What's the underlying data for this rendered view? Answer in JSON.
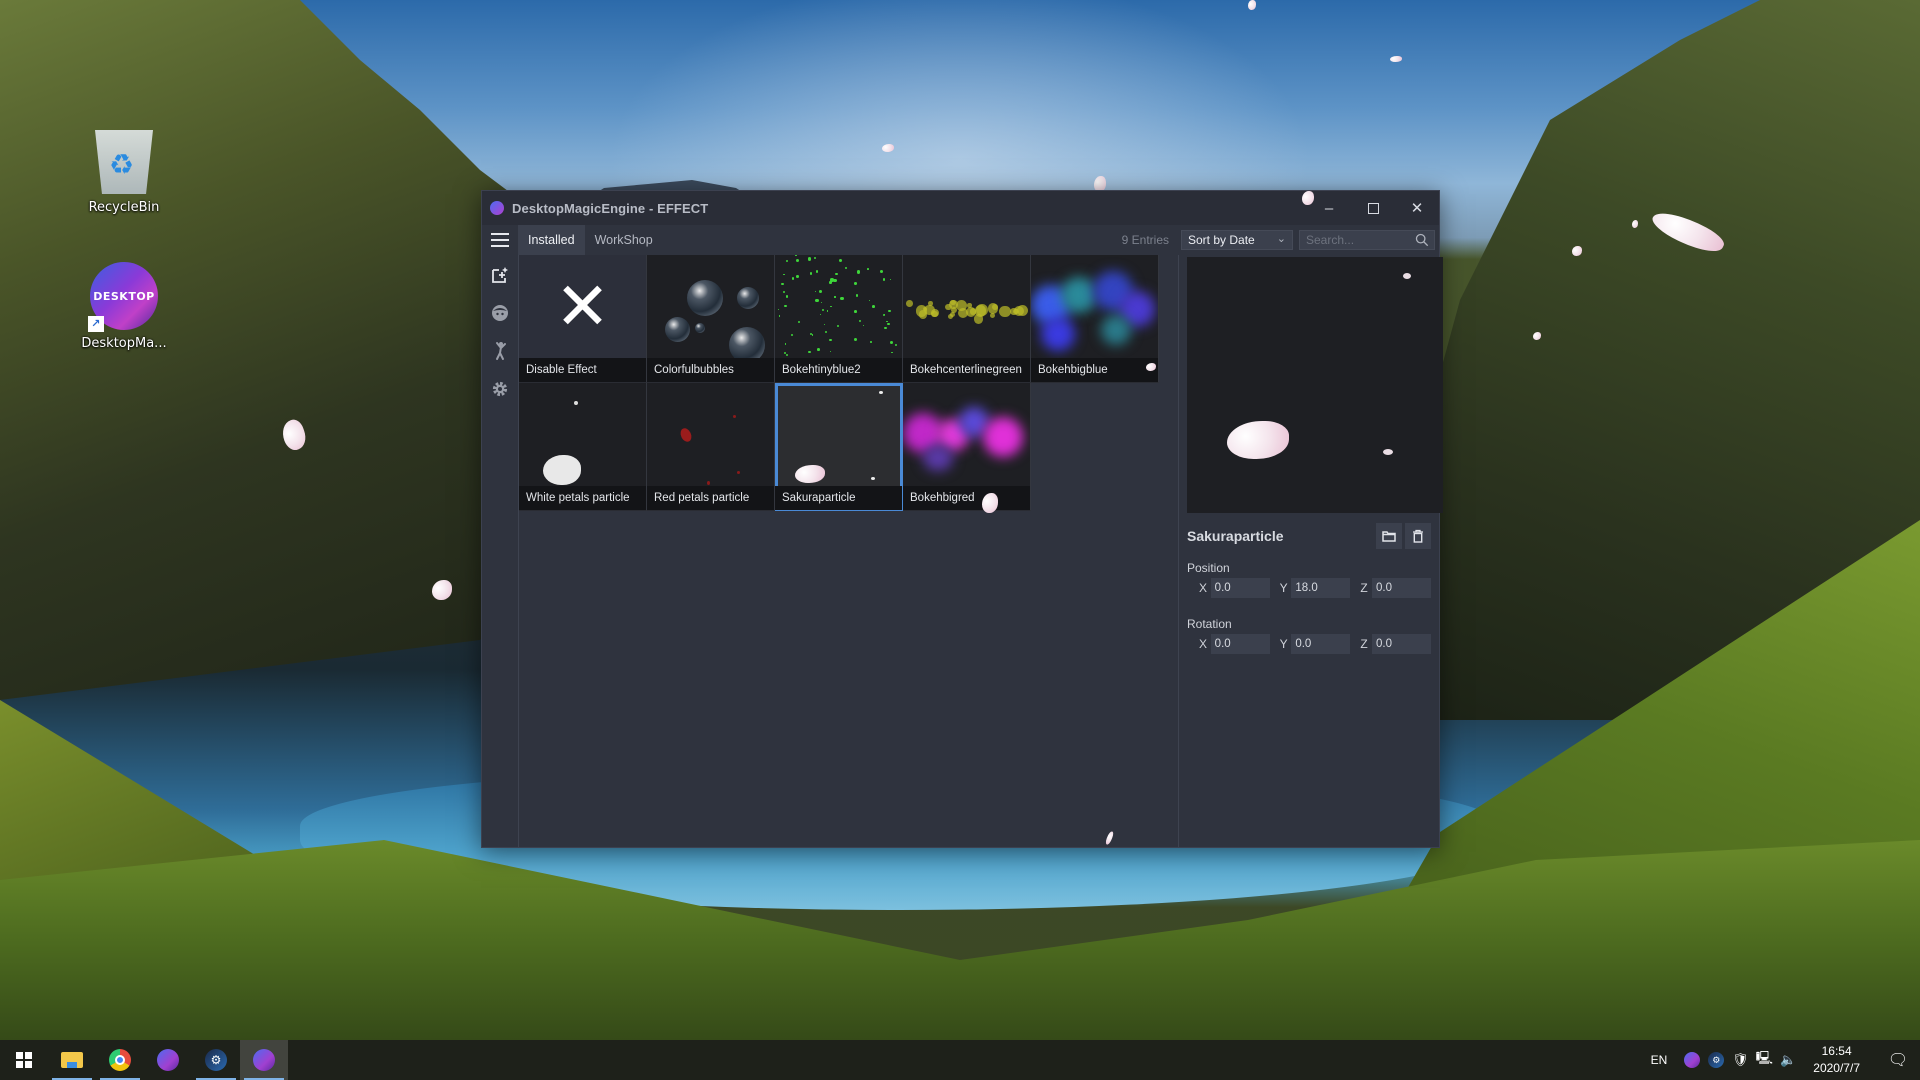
{
  "desktop": {
    "icons": [
      {
        "label": "RecycleBin"
      },
      {
        "label": "DesktopMa...",
        "orb_text": "DESKTOP"
      }
    ]
  },
  "window": {
    "title": "DesktopMagicEngine - EFFECT",
    "controls": {
      "minimize": "–",
      "close": "✕"
    },
    "tabs": [
      {
        "label": "Installed",
        "active": true
      },
      {
        "label": "WorkShop",
        "active": false
      }
    ],
    "entries_count": "9 Entries",
    "sort": {
      "selected": "Sort by Date",
      "chevron": "⌵"
    },
    "search": {
      "placeholder": "Search...",
      "value": ""
    },
    "sidebar": [
      {
        "name": "add-effect"
      },
      {
        "name": "character"
      },
      {
        "name": "motion"
      },
      {
        "name": "settings"
      }
    ],
    "effects": [
      {
        "label": "Disable Effect",
        "selected": false
      },
      {
        "label": "Colorfulbubbles",
        "selected": false
      },
      {
        "label": "Bokehtinyblue2",
        "selected": false
      },
      {
        "label": "Bokehcenterlinegreen",
        "selected": false
      },
      {
        "label": "Bokehbigblue",
        "selected": false
      },
      {
        "label": "White petals particle",
        "selected": false
      },
      {
        "label": "Red petals particle",
        "selected": false
      },
      {
        "label": "Sakuraparticle",
        "selected": true
      },
      {
        "label": "Bokehbigred",
        "selected": false
      }
    ],
    "detail": {
      "title": "Sakuraparticle",
      "position": {
        "label": "Position",
        "x": "0.0",
        "y": "18.0",
        "z": "0.0"
      },
      "rotation": {
        "label": "Rotation",
        "x": "0.0",
        "y": "0.0",
        "z": "0.0"
      },
      "axis_labels": {
        "x": "X",
        "y": "Y",
        "z": "Z"
      }
    },
    "colors": {
      "accent": "#4a8ad6",
      "window_bg": "#2f333e",
      "titlebar_bg": "#2a2d37"
    }
  },
  "taskbar": {
    "apps": [
      "start",
      "file-explorer",
      "chrome",
      "desktop-magic-engine",
      "steam",
      "desktop-magic-engine-active"
    ],
    "tray": {
      "language": "EN",
      "time": "16:54",
      "date": "2020/7/7"
    }
  }
}
